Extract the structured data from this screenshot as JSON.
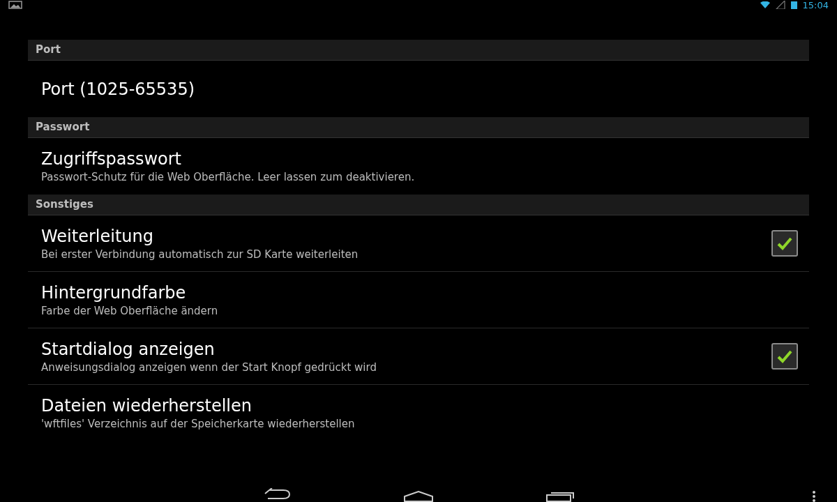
{
  "status_bar": {
    "time": "15:04"
  },
  "sections": [
    {
      "title": "Port",
      "items": [
        {
          "kind": "plain",
          "title": "Port (1025-65535)"
        }
      ]
    },
    {
      "title": "Passwort",
      "items": [
        {
          "kind": "plain",
          "title": "Zugriffspasswort",
          "summary": "Passwort-Schutz für die Web Oberfläche. Leer lassen zum deaktivieren."
        }
      ]
    },
    {
      "title": "Sonstiges",
      "items": [
        {
          "kind": "checkbox",
          "title": "Weiterleitung",
          "summary": "Bei erster Verbindung automatisch zur SD Karte weiterleiten",
          "checked": true
        },
        {
          "kind": "plain",
          "title": "Hintergrundfarbe",
          "summary": "Farbe der Web Oberfläche ändern"
        },
        {
          "kind": "checkbox",
          "title": "Startdialog anzeigen",
          "summary": "Anweisungsdialog anzeigen wenn der Start Knopf gedrückt wird",
          "checked": true
        },
        {
          "kind": "plain",
          "title": "Dateien wiederherstellen",
          "summary": "'wftfiles' Verzeichnis auf der Speicherkarte wiederherstellen"
        }
      ]
    }
  ]
}
